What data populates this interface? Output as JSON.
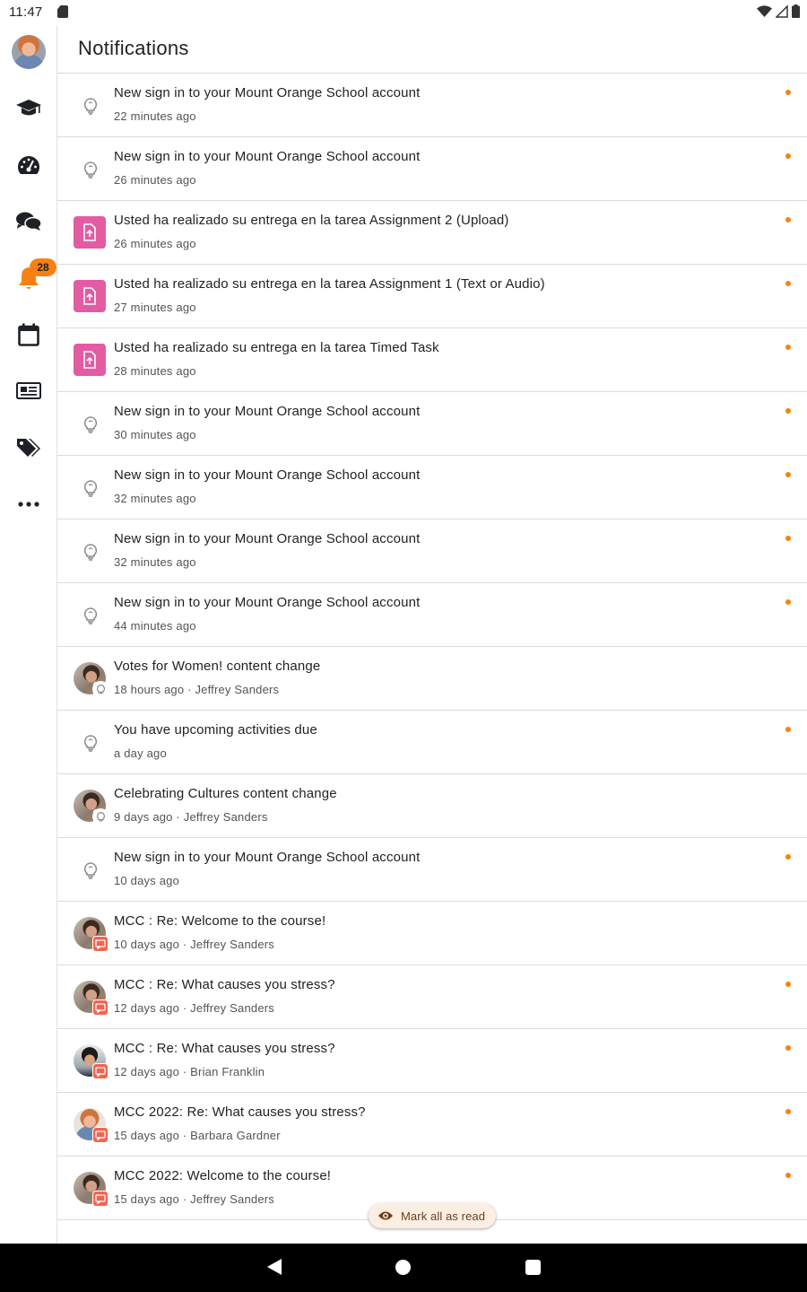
{
  "status_bar": {
    "time": "11:47"
  },
  "header": {
    "title": "Notifications"
  },
  "sidebar": {
    "items": [
      {
        "name": "user-avatar"
      },
      {
        "name": "courses-icon"
      },
      {
        "name": "dashboard-icon"
      },
      {
        "name": "messages-icon"
      },
      {
        "name": "notifications-bell-icon"
      },
      {
        "name": "calendar-icon"
      },
      {
        "name": "news-icon"
      },
      {
        "name": "tags-icon"
      },
      {
        "name": "more-icon"
      }
    ],
    "notification_count": "28"
  },
  "notifications": [
    {
      "type": "system",
      "title": "New sign in to your Mount Orange School account",
      "meta": "22 minutes ago",
      "unread": true
    },
    {
      "type": "system",
      "title": "New sign in to your Mount Orange School account",
      "meta": "26 minutes ago",
      "unread": true
    },
    {
      "type": "assign",
      "title": "Usted ha realizado su entrega en la tarea Assignment 2 (Upload)",
      "meta": "26 minutes ago",
      "unread": true
    },
    {
      "type": "assign",
      "title": "Usted ha realizado su entrega en la tarea Assignment 1 (Text or Audio)",
      "meta": "27 minutes ago",
      "unread": true
    },
    {
      "type": "assign",
      "title": "Usted ha realizado su entrega en la tarea Timed Task",
      "meta": "28 minutes ago",
      "unread": true
    },
    {
      "type": "system",
      "title": "New sign in to your Mount Orange School account",
      "meta": "30 minutes ago",
      "unread": true
    },
    {
      "type": "system",
      "title": "New sign in to your Mount Orange School account",
      "meta": "32 minutes ago",
      "unread": true
    },
    {
      "type": "system",
      "title": "New sign in to your Mount Orange School account",
      "meta": "32 minutes ago",
      "unread": true
    },
    {
      "type": "system",
      "title": "New sign in to your Mount Orange School account",
      "meta": "44 minutes ago",
      "unread": true
    },
    {
      "type": "user-bulb",
      "pic": "jeffrey",
      "title": "Votes for Women! content change",
      "meta": "18 hours ago · Jeffrey Sanders",
      "unread": false
    },
    {
      "type": "system",
      "title": "You have upcoming activities due",
      "meta": "a day ago",
      "unread": true
    },
    {
      "type": "user-bulb",
      "pic": "jeffrey",
      "title": "Celebrating Cultures content change",
      "meta": "9 days ago · Jeffrey Sanders",
      "unread": false
    },
    {
      "type": "system",
      "title": "New sign in to your Mount Orange School account",
      "meta": "10 days ago",
      "unread": true
    },
    {
      "type": "user-forum",
      "pic": "jeffrey",
      "title": "MCC : Re: Welcome to the course!",
      "meta": "10 days ago · Jeffrey Sanders",
      "unread": false
    },
    {
      "type": "user-forum",
      "pic": "jeffrey",
      "title": "MCC : Re: What causes you stress?",
      "meta": "12 days ago · Jeffrey Sanders",
      "unread": true
    },
    {
      "type": "user-forum",
      "pic": "brian",
      "title": "MCC : Re: What causes you stress?",
      "meta": "12 days ago · Brian Franklin",
      "unread": true
    },
    {
      "type": "user-forum",
      "pic": "barbara",
      "title": "MCC 2022: Re: What causes you stress?",
      "meta": "15 days ago · Barbara Gardner",
      "unread": true
    },
    {
      "type": "user-forum",
      "pic": "jeffrey",
      "title": "MCC 2022: Welcome to the course!",
      "meta": "15 days ago · Jeffrey Sanders",
      "unread": true
    }
  ],
  "mark_all": {
    "label": "Mark all as read"
  },
  "colors": {
    "accent": "#f98012",
    "assign": "#e35ba3",
    "forum": "#f7634d"
  }
}
